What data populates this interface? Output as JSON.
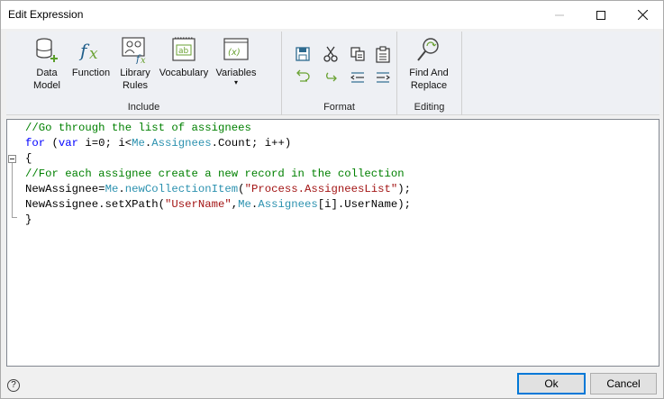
{
  "window": {
    "title": "Edit Expression",
    "controls": {
      "minimize": "minimize",
      "maximize": "maximize",
      "close": "close"
    }
  },
  "ribbon": {
    "include": {
      "label": "Include",
      "buttons": [
        {
          "label_line1": "Data",
          "label_line2": "Model",
          "icon": "database-add-icon"
        },
        {
          "label_line1": "Function",
          "label_line2": "",
          "icon": "fx-icon"
        },
        {
          "label_line1": "Library",
          "label_line2": "Rules",
          "icon": "library-rules-icon"
        },
        {
          "label_line1": "Vocabulary",
          "label_line2": "",
          "icon": "vocabulary-icon"
        },
        {
          "label_line1": "Variables",
          "label_line2": "▾",
          "icon": "variables-icon"
        }
      ]
    },
    "format": {
      "label": "Format",
      "icons": [
        "save-icon",
        "cut-icon",
        "copy-icon",
        "paste-icon",
        "undo-icon",
        "redo-icon",
        "outdent-icon",
        "indent-icon"
      ]
    },
    "editing": {
      "label": "Editing",
      "buttons": [
        {
          "label_line1": "Find And",
          "label_line2": "Replace",
          "icon": "find-replace-icon"
        }
      ]
    }
  },
  "editor": {
    "lines": [
      [
        {
          "t": "//Go through the list of assignees",
          "c": "comment"
        }
      ],
      [
        {
          "t": "for",
          "c": "kw"
        },
        {
          "t": " (",
          "c": "plain"
        },
        {
          "t": "var",
          "c": "kw"
        },
        {
          "t": " i=0; i<",
          "c": "plain"
        },
        {
          "t": "Me",
          "c": "id"
        },
        {
          "t": ".",
          "c": "plain"
        },
        {
          "t": "Assignees",
          "c": "id"
        },
        {
          "t": ".Count; i++)",
          "c": "plain"
        }
      ],
      [
        {
          "t": "{",
          "c": "plain"
        }
      ],
      [
        {
          "t": "//For each assignee create a new record in the collection",
          "c": "comment"
        }
      ],
      [
        {
          "t": "NewAssignee=",
          "c": "plain"
        },
        {
          "t": "Me",
          "c": "id"
        },
        {
          "t": ".",
          "c": "plain"
        },
        {
          "t": "newCollectionItem",
          "c": "id"
        },
        {
          "t": "(",
          "c": "plain"
        },
        {
          "t": "\"Process.AssigneesList\"",
          "c": "str"
        },
        {
          "t": ");",
          "c": "plain"
        }
      ],
      [
        {
          "t": "NewAssignee.setXPath(",
          "c": "plain"
        },
        {
          "t": "\"UserName\"",
          "c": "str"
        },
        {
          "t": ",",
          "c": "plain"
        },
        {
          "t": "Me",
          "c": "id"
        },
        {
          "t": ".",
          "c": "plain"
        },
        {
          "t": "Assignees",
          "c": "id"
        },
        {
          "t": "[i].UserName);",
          "c": "plain"
        }
      ],
      [
        {
          "t": "}",
          "c": "plain"
        }
      ]
    ]
  },
  "footer": {
    "help": "?",
    "ok_label": "Ok",
    "cancel_label": "Cancel"
  },
  "colors": {
    "comment": "#008000",
    "keyword": "#0000ff",
    "identifier": "#2b91af",
    "string": "#a31515",
    "accent": "#0078d7"
  }
}
